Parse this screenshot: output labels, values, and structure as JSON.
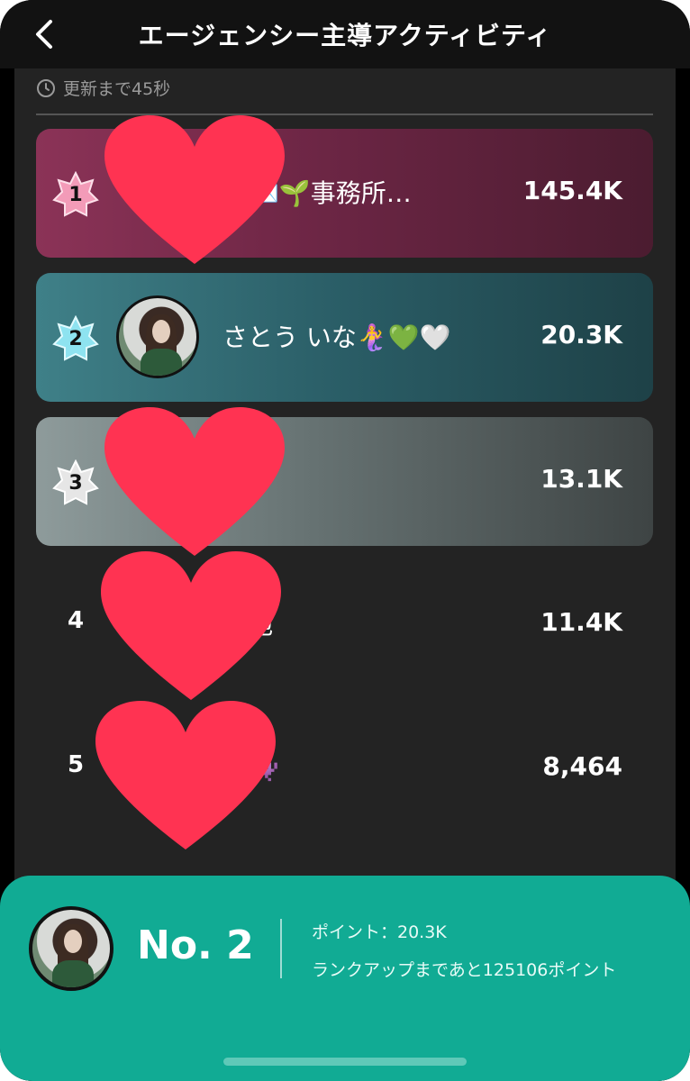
{
  "header": {
    "title": "エージェンシー主導アクティビティ"
  },
  "update_text": "更新まで45秒",
  "ranking": [
    {
      "rank": "1",
      "name": "り💌🌱事務所…",
      "score": "145.4K"
    },
    {
      "rank": "2",
      "name": "さとう いな🧜‍♀️💚🤍",
      "score": "20.3K"
    },
    {
      "rank": "3",
      "name": "ぎり",
      "score": "13.1K"
    },
    {
      "rank": "4",
      "name": "細胞",
      "score": "11.4K"
    },
    {
      "rank": "5",
      "name": "ん👾",
      "score": "8,464"
    }
  ],
  "me": {
    "rank_label": "No. 2",
    "points": "ポイント：20.3K",
    "next_rank": "ランクアップまであと125106ポイント"
  },
  "colors": {
    "accent_bottom": "#11ab94",
    "heart": "#ff3352",
    "badge_1": "#f39bb8",
    "badge_2": "#8ee3f0",
    "badge_3": "#e6e6e6"
  }
}
